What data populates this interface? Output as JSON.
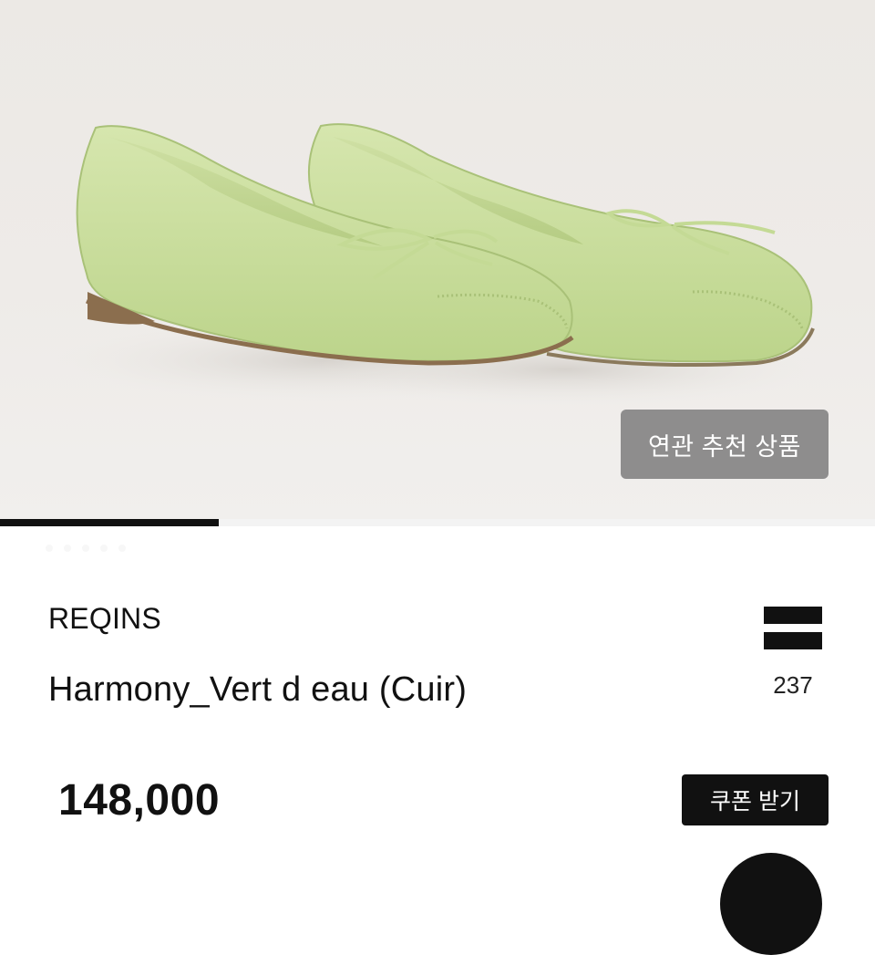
{
  "hero": {
    "related_button_label": "연관 추천 상품",
    "image_subject": "light green leather ballet flats with bow"
  },
  "gallery": {
    "progress_fraction": 0.25,
    "dot_count": 5
  },
  "product": {
    "brand": "REQINS",
    "name": "Harmony_Vert d eau (Cuir)",
    "like_count": "237",
    "price": "148,000"
  },
  "actions": {
    "coupon_label": "쿠폰 받기"
  },
  "colors": {
    "accent": "#111111",
    "shoe": "#c9df9c",
    "background": "#eceae6"
  },
  "icons": {
    "like": "menu-bars-icon"
  }
}
